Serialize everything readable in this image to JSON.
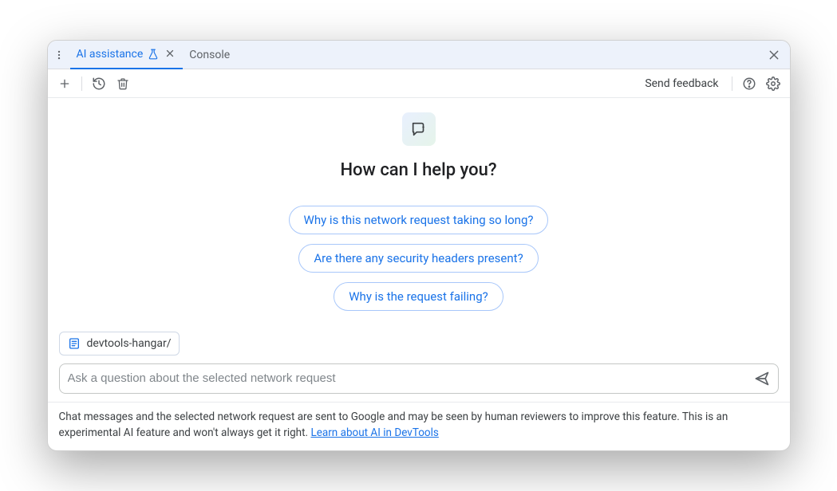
{
  "tabs": {
    "active": "AI assistance",
    "secondary": "Console"
  },
  "toolbar": {
    "feedback": "Send feedback"
  },
  "hero": {
    "title": "How can I help you?",
    "suggestions": [
      "Why is this network request taking so long?",
      "Are there any security headers present?",
      "Why is the request failing?"
    ]
  },
  "context": {
    "label": "devtools-hangar/"
  },
  "input": {
    "placeholder": "Ask a question about the selected network request"
  },
  "footer": {
    "text": "Chat messages and the selected network request are sent to Google and may be seen by human reviewers to improve this feature. This is an experimental AI feature and won't always get it right. ",
    "link": "Learn about AI in DevTools"
  }
}
